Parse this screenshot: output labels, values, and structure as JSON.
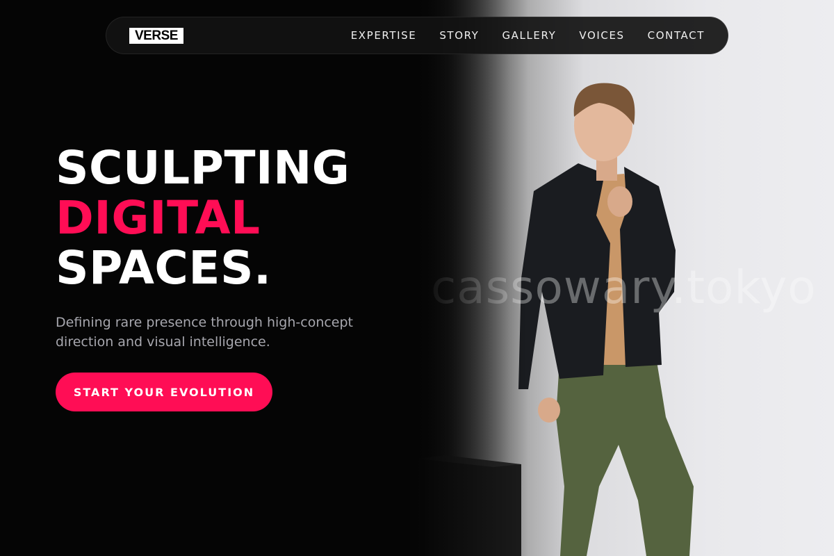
{
  "brand": {
    "logo_text": "VERSE"
  },
  "nav": {
    "items": [
      {
        "label": "EXPERTISE"
      },
      {
        "label": "STORY"
      },
      {
        "label": "GALLERY"
      },
      {
        "label": "VOICES"
      },
      {
        "label": "CONTACT"
      }
    ]
  },
  "hero": {
    "title_line1": "SCULPTING",
    "title_line2": "DIGITAL",
    "title_line3": "SPACES.",
    "subtitle": "Defining rare presence through high-concept direction and visual intelligence.",
    "cta_label": "START YOUR EVOLUTION"
  },
  "photo": {
    "watermark": "cassowary.tokyo"
  },
  "colors": {
    "accent": "#ff0d55",
    "background": "#050505",
    "nav_background": "#121212",
    "text_primary": "#ffffff",
    "text_muted": "#a7a7ae"
  }
}
